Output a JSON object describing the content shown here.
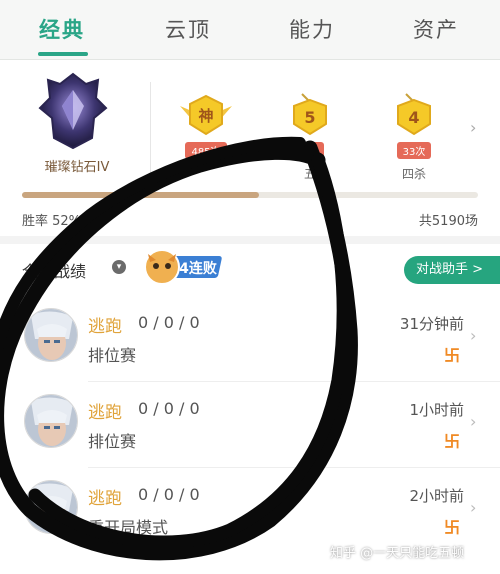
{
  "tabs": [
    {
      "label": "经典",
      "active": true
    },
    {
      "label": "云顶",
      "active": false
    },
    {
      "label": "能力",
      "active": false
    },
    {
      "label": "资产",
      "active": false
    }
  ],
  "profile": {
    "rank_name": "璀璨钻石IV",
    "medals": [
      {
        "icon": "legendary-medal-icon",
        "glyph": "神",
        "count": "485次",
        "label": ""
      },
      {
        "icon": "penta-kill-medal-icon",
        "glyph": "5",
        "count": "3次",
        "label": "五"
      },
      {
        "icon": "quadra-kill-medal-icon",
        "glyph": "4",
        "count": "33次",
        "label": "四杀"
      }
    ],
    "win_rate_label": "胜率 52%",
    "win_rate_fraction": 0.52,
    "total_games": "共5190场"
  },
  "records": {
    "title": "全部战绩",
    "streak_badge": "4连败",
    "assist_button": "对战助手 >",
    "matches": [
      {
        "result": "逃跑",
        "kda": "0 / 0 / 0",
        "mode": "排位赛",
        "time": "31分钟前"
      },
      {
        "result": "逃跑",
        "kda": "0 / 0 / 0",
        "mode": "排位赛",
        "time": "1小时前"
      },
      {
        "result": "逃跑",
        "kda": "0 / 0 / 0",
        "mode": "重开局模式",
        "time": "2小时前"
      }
    ]
  },
  "watermark": "知乎 @一天只能吃五顿",
  "colors": {
    "accent": "#2aa587",
    "escape_result": "#e0a33a",
    "progress": "#c9a57f",
    "medal_gold": "#f5c928",
    "count_badge": "#e56a58"
  }
}
